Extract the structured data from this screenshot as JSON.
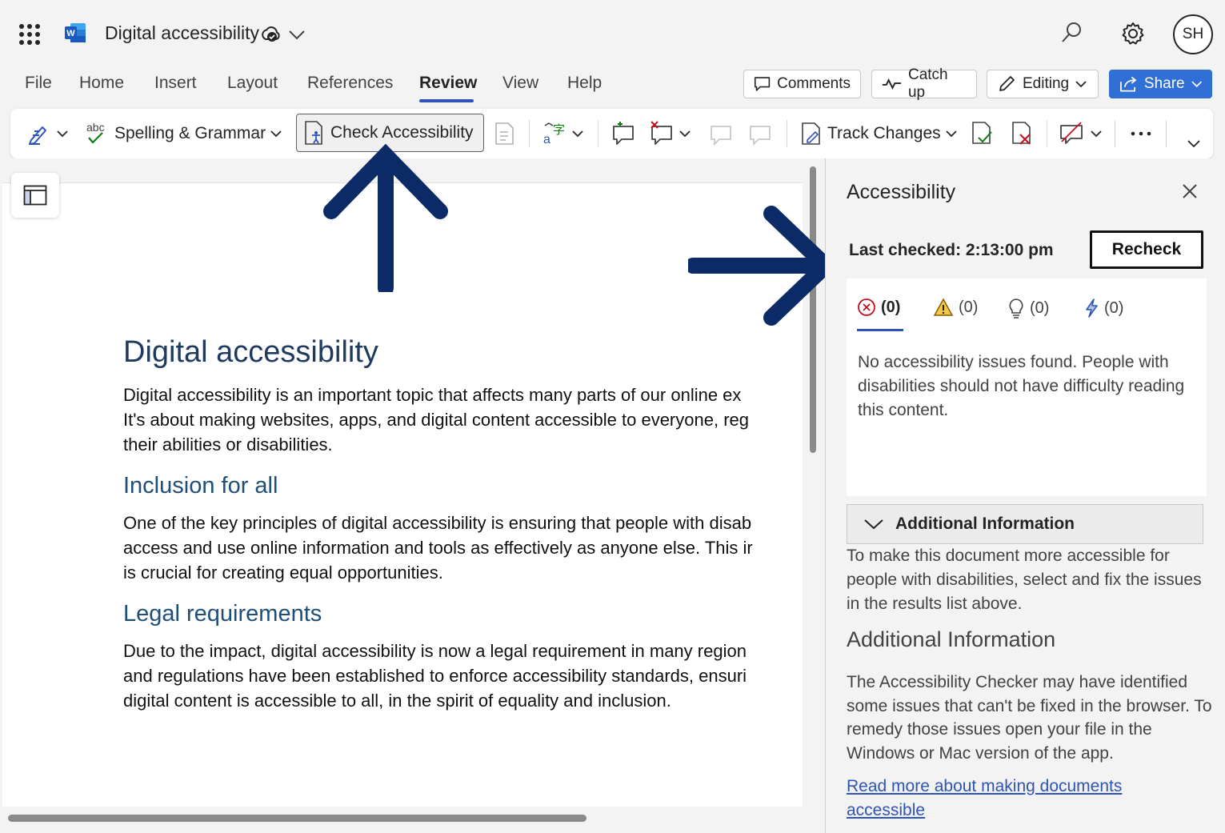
{
  "app": {
    "title": "Digital accessibility",
    "avatar_initials": "SH"
  },
  "menu": {
    "tabs": [
      "File",
      "Home",
      "Insert",
      "Layout",
      "References",
      "Review",
      "View",
      "Help"
    ],
    "active_tab": "Review"
  },
  "toolbar": {
    "comments_label": "Comments",
    "catchup_label": "Catch up",
    "editing_label": "Editing",
    "share_label": "Share"
  },
  "ribbon": {
    "spelling_abc": "abc",
    "spelling_label": "Spelling & Grammar",
    "check_accessibility_label": "Check Accessibility",
    "track_changes_label": "Track Changes"
  },
  "document": {
    "heading": "Digital accessibility",
    "para1_lines": [
      "Digital accessibility is an important topic that affects many parts of our online ex",
      "It's about making websites, apps, and digital content accessible to everyone, reg",
      "their abilities or disabilities."
    ],
    "h2_inclusion": "Inclusion for all",
    "para2_lines": [
      "One of the key principles of digital accessibility is ensuring that people with disab",
      "access and use online information and tools as effectively as anyone else. This ir",
      "is crucial for creating equal opportunities."
    ],
    "h2_legal": "Legal requirements",
    "para3_lines": [
      "Due to the impact, digital accessibility is now a legal requirement in many region",
      "and regulations have been established to enforce accessibility standards, ensuri",
      "digital content is accessible to all, in the spirit of equality and inclusion."
    ]
  },
  "accessibility_pane": {
    "title": "Accessibility",
    "last_checked": "Last checked: 2:13:00 pm",
    "recheck_label": "Recheck",
    "counts": {
      "errors": "(0)",
      "warnings": "(0)",
      "tips": "(0)",
      "intelligent": "(0)"
    },
    "no_issues_text": "No accessibility issues found. People with disabilities should not have difficulty reading this content.",
    "additional_info_header": "Additional Information",
    "additional_info_text": "To make this document more accessible for people with disabilities, select and fix the issues in the results list above.",
    "additional_info_heading": "Additional Information",
    "additional_info_body": "The Accessibility Checker may have identified some issues that can't be fixed in the browser. To remedy those issues open your file in the Windows or Mac version of the app.",
    "read_more_link": "Read more about making documents accessible"
  },
  "colors": {
    "accent": "#2f54b8",
    "share_button": "#2f6fd6",
    "annotation_arrow": "#0b2a66",
    "heading": "#1f3a5f"
  }
}
